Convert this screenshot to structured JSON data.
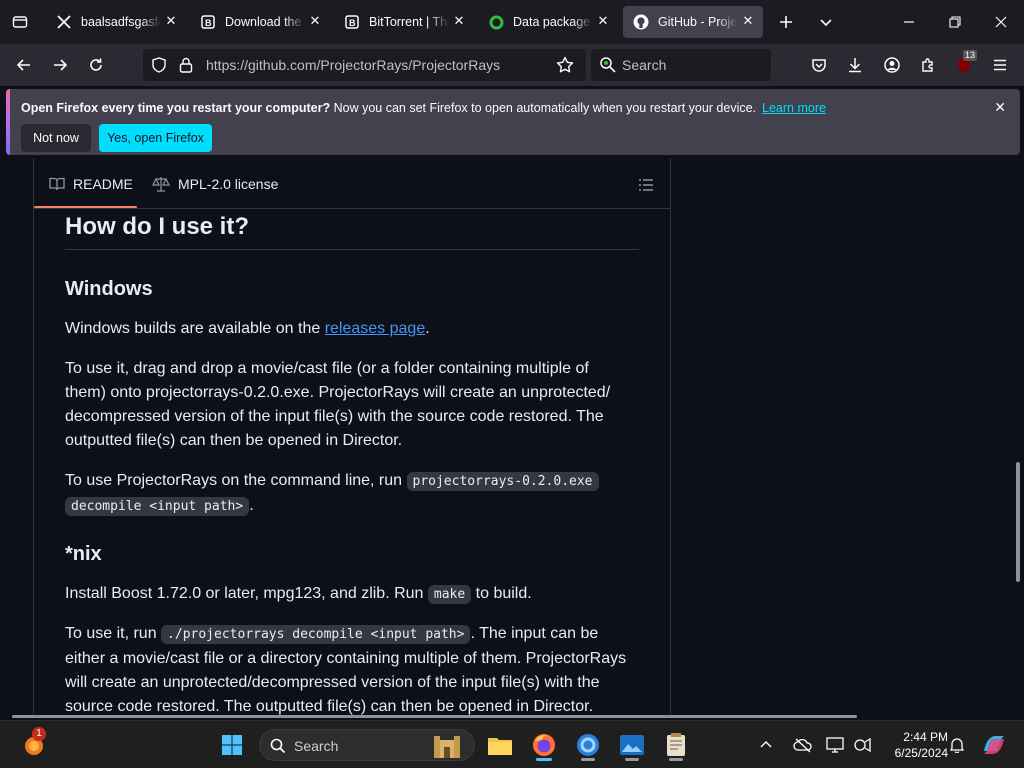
{
  "tabs": [
    {
      "title": "baalsadfsgasfd (",
      "icon": "x-logo-icon"
    },
    {
      "title": "Download the Bi",
      "icon": "bittorrent-b-icon"
    },
    {
      "title": "BitTorrent | The W",
      "icon": "bittorrent-b-icon"
    },
    {
      "title": "Data package fro",
      "icon": "data-ring-icon"
    },
    {
      "title": "GitHub - Projecto",
      "icon": "github-icon",
      "active": true
    }
  ],
  "url": "https://github.com/ProjectorRays/ProjectorRays",
  "search_placeholder": "Search",
  "notification": {
    "bold": "Open Firefox every time you restart your computer?",
    "text": " Now you can set Firefox to open automatically when you restart your device.",
    "link": "Learn more",
    "not_now": "Not now",
    "yes": "Yes, open Firefox"
  },
  "extension_badge": "13",
  "readme_tabs": {
    "readme": "README",
    "license": "MPL-2.0 license"
  },
  "content": {
    "h2": "How do I use it?",
    "windows_h": "Windows",
    "windows_p_before": "Windows builds are available on the ",
    "windows_p_link": "releases page",
    "windows_p_after": ".",
    "drag_p_1": "To use it, drag and drop a movie/cast file (or a folder containing multiple of",
    "drag_p_2": "them) onto projectorrays-0.2.0.exe. ProjectorRays will create an unprotected/",
    "drag_p_3": "decompressed version of the input file(s) with the source code restored. The",
    "drag_p_4": "outputted file(s) can then be opened in Director.",
    "cli_before": "To use ProjectorRays on the command line, run ",
    "cli_code_1": "projectorrays-0.2.0.exe",
    "cli_code_2": "decompile <input path>",
    "cli_after": ".",
    "nix_h": "*nix",
    "boost_before": "Install Boost 1.72.0 or later, mpg123, and zlib. Run ",
    "boost_code": "make",
    "boost_after": " to build.",
    "run_before": "To use it, run ",
    "run_code": "./projectorrays decompile <input path>",
    "run_after": ". The input can be",
    "run_2": "either a movie/cast file or a directory containing multiple of them. ProjectorRays",
    "run_3": "will create an unprotected/decompressed version of the input file(s) with the",
    "run_4": "source code restored. The outputted file(s) can then be opened in Director."
  },
  "taskbar": {
    "search": "Search",
    "time": "2:44 PM",
    "date": "6/25/2024",
    "notif_badge": "1"
  }
}
